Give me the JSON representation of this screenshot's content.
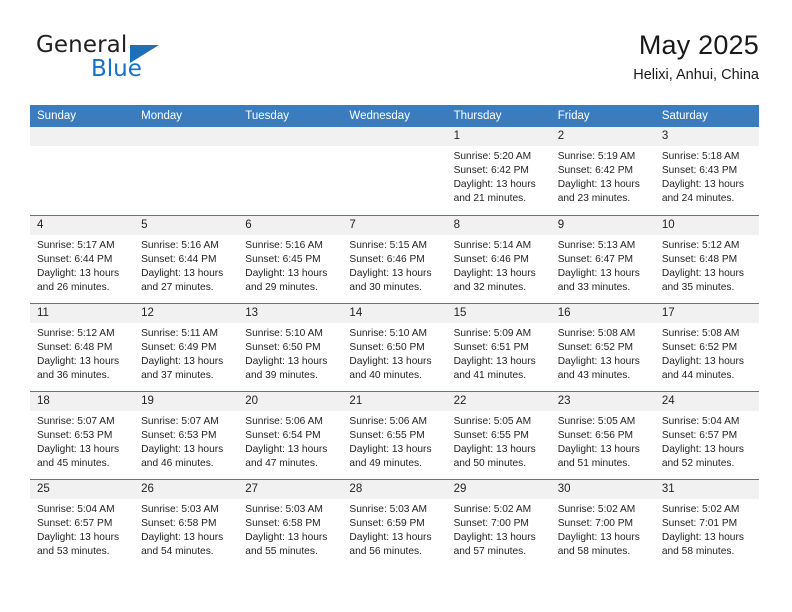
{
  "brand": {
    "name_line1": "General",
    "name_line2": "Blue",
    "flag_icon": "triangle-flag-icon",
    "accent_color": "#1771c2"
  },
  "header": {
    "title": "May 2025",
    "subtitle": "Helixi, Anhui, China"
  },
  "theme": {
    "header_blue": "#3a7cbe",
    "date_band_gray": "#f1f1f1",
    "text_color": "#231f20"
  },
  "weekdays": [
    "Sunday",
    "Monday",
    "Tuesday",
    "Wednesday",
    "Thursday",
    "Friday",
    "Saturday"
  ],
  "weeks": [
    [
      {
        "day": "",
        "sunrise": "",
        "sunset": "",
        "daylight1": "",
        "daylight2": ""
      },
      {
        "day": "",
        "sunrise": "",
        "sunset": "",
        "daylight1": "",
        "daylight2": ""
      },
      {
        "day": "",
        "sunrise": "",
        "sunset": "",
        "daylight1": "",
        "daylight2": ""
      },
      {
        "day": "",
        "sunrise": "",
        "sunset": "",
        "daylight1": "",
        "daylight2": ""
      },
      {
        "day": "1",
        "sunrise": "Sunrise: 5:20 AM",
        "sunset": "Sunset: 6:42 PM",
        "daylight1": "Daylight: 13 hours",
        "daylight2": "and 21 minutes."
      },
      {
        "day": "2",
        "sunrise": "Sunrise: 5:19 AM",
        "sunset": "Sunset: 6:42 PM",
        "daylight1": "Daylight: 13 hours",
        "daylight2": "and 23 minutes."
      },
      {
        "day": "3",
        "sunrise": "Sunrise: 5:18 AM",
        "sunset": "Sunset: 6:43 PM",
        "daylight1": "Daylight: 13 hours",
        "daylight2": "and 24 minutes."
      }
    ],
    [
      {
        "day": "4",
        "sunrise": "Sunrise: 5:17 AM",
        "sunset": "Sunset: 6:44 PM",
        "daylight1": "Daylight: 13 hours",
        "daylight2": "and 26 minutes."
      },
      {
        "day": "5",
        "sunrise": "Sunrise: 5:16 AM",
        "sunset": "Sunset: 6:44 PM",
        "daylight1": "Daylight: 13 hours",
        "daylight2": "and 27 minutes."
      },
      {
        "day": "6",
        "sunrise": "Sunrise: 5:16 AM",
        "sunset": "Sunset: 6:45 PM",
        "daylight1": "Daylight: 13 hours",
        "daylight2": "and 29 minutes."
      },
      {
        "day": "7",
        "sunrise": "Sunrise: 5:15 AM",
        "sunset": "Sunset: 6:46 PM",
        "daylight1": "Daylight: 13 hours",
        "daylight2": "and 30 minutes."
      },
      {
        "day": "8",
        "sunrise": "Sunrise: 5:14 AM",
        "sunset": "Sunset: 6:46 PM",
        "daylight1": "Daylight: 13 hours",
        "daylight2": "and 32 minutes."
      },
      {
        "day": "9",
        "sunrise": "Sunrise: 5:13 AM",
        "sunset": "Sunset: 6:47 PM",
        "daylight1": "Daylight: 13 hours",
        "daylight2": "and 33 minutes."
      },
      {
        "day": "10",
        "sunrise": "Sunrise: 5:12 AM",
        "sunset": "Sunset: 6:48 PM",
        "daylight1": "Daylight: 13 hours",
        "daylight2": "and 35 minutes."
      }
    ],
    [
      {
        "day": "11",
        "sunrise": "Sunrise: 5:12 AM",
        "sunset": "Sunset: 6:48 PM",
        "daylight1": "Daylight: 13 hours",
        "daylight2": "and 36 minutes."
      },
      {
        "day": "12",
        "sunrise": "Sunrise: 5:11 AM",
        "sunset": "Sunset: 6:49 PM",
        "daylight1": "Daylight: 13 hours",
        "daylight2": "and 37 minutes."
      },
      {
        "day": "13",
        "sunrise": "Sunrise: 5:10 AM",
        "sunset": "Sunset: 6:50 PM",
        "daylight1": "Daylight: 13 hours",
        "daylight2": "and 39 minutes."
      },
      {
        "day": "14",
        "sunrise": "Sunrise: 5:10 AM",
        "sunset": "Sunset: 6:50 PM",
        "daylight1": "Daylight: 13 hours",
        "daylight2": "and 40 minutes."
      },
      {
        "day": "15",
        "sunrise": "Sunrise: 5:09 AM",
        "sunset": "Sunset: 6:51 PM",
        "daylight1": "Daylight: 13 hours",
        "daylight2": "and 41 minutes."
      },
      {
        "day": "16",
        "sunrise": "Sunrise: 5:08 AM",
        "sunset": "Sunset: 6:52 PM",
        "daylight1": "Daylight: 13 hours",
        "daylight2": "and 43 minutes."
      },
      {
        "day": "17",
        "sunrise": "Sunrise: 5:08 AM",
        "sunset": "Sunset: 6:52 PM",
        "daylight1": "Daylight: 13 hours",
        "daylight2": "and 44 minutes."
      }
    ],
    [
      {
        "day": "18",
        "sunrise": "Sunrise: 5:07 AM",
        "sunset": "Sunset: 6:53 PM",
        "daylight1": "Daylight: 13 hours",
        "daylight2": "and 45 minutes."
      },
      {
        "day": "19",
        "sunrise": "Sunrise: 5:07 AM",
        "sunset": "Sunset: 6:53 PM",
        "daylight1": "Daylight: 13 hours",
        "daylight2": "and 46 minutes."
      },
      {
        "day": "20",
        "sunrise": "Sunrise: 5:06 AM",
        "sunset": "Sunset: 6:54 PM",
        "daylight1": "Daylight: 13 hours",
        "daylight2": "and 47 minutes."
      },
      {
        "day": "21",
        "sunrise": "Sunrise: 5:06 AM",
        "sunset": "Sunset: 6:55 PM",
        "daylight1": "Daylight: 13 hours",
        "daylight2": "and 49 minutes."
      },
      {
        "day": "22",
        "sunrise": "Sunrise: 5:05 AM",
        "sunset": "Sunset: 6:55 PM",
        "daylight1": "Daylight: 13 hours",
        "daylight2": "and 50 minutes."
      },
      {
        "day": "23",
        "sunrise": "Sunrise: 5:05 AM",
        "sunset": "Sunset: 6:56 PM",
        "daylight1": "Daylight: 13 hours",
        "daylight2": "and 51 minutes."
      },
      {
        "day": "24",
        "sunrise": "Sunrise: 5:04 AM",
        "sunset": "Sunset: 6:57 PM",
        "daylight1": "Daylight: 13 hours",
        "daylight2": "and 52 minutes."
      }
    ],
    [
      {
        "day": "25",
        "sunrise": "Sunrise: 5:04 AM",
        "sunset": "Sunset: 6:57 PM",
        "daylight1": "Daylight: 13 hours",
        "daylight2": "and 53 minutes."
      },
      {
        "day": "26",
        "sunrise": "Sunrise: 5:03 AM",
        "sunset": "Sunset: 6:58 PM",
        "daylight1": "Daylight: 13 hours",
        "daylight2": "and 54 minutes."
      },
      {
        "day": "27",
        "sunrise": "Sunrise: 5:03 AM",
        "sunset": "Sunset: 6:58 PM",
        "daylight1": "Daylight: 13 hours",
        "daylight2": "and 55 minutes."
      },
      {
        "day": "28",
        "sunrise": "Sunrise: 5:03 AM",
        "sunset": "Sunset: 6:59 PM",
        "daylight1": "Daylight: 13 hours",
        "daylight2": "and 56 minutes."
      },
      {
        "day": "29",
        "sunrise": "Sunrise: 5:02 AM",
        "sunset": "Sunset: 7:00 PM",
        "daylight1": "Daylight: 13 hours",
        "daylight2": "and 57 minutes."
      },
      {
        "day": "30",
        "sunrise": "Sunrise: 5:02 AM",
        "sunset": "Sunset: 7:00 PM",
        "daylight1": "Daylight: 13 hours",
        "daylight2": "and 58 minutes."
      },
      {
        "day": "31",
        "sunrise": "Sunrise: 5:02 AM",
        "sunset": "Sunset: 7:01 PM",
        "daylight1": "Daylight: 13 hours",
        "daylight2": "and 58 minutes."
      }
    ]
  ]
}
